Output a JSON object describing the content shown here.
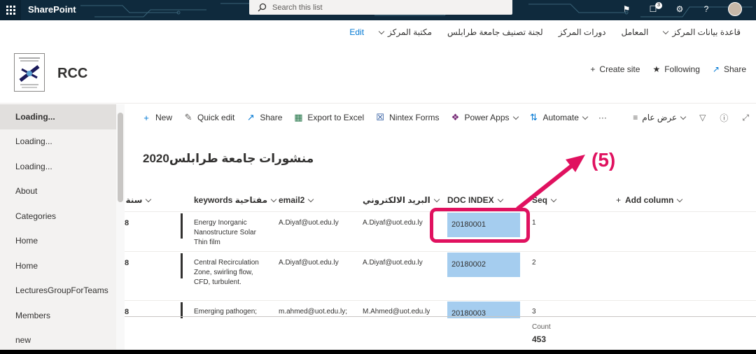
{
  "suitebar": {
    "app_name": "SharePoint",
    "search_placeholder": "Search this list",
    "notification_count": "3"
  },
  "hubnav": {
    "items": [
      "قاعدة بيانات المركز",
      "المعامل",
      "دورات المركز",
      "لجنة تصنيف جامعة طرابلس",
      "مكتبة المركز",
      "Edit"
    ]
  },
  "site": {
    "title": "RCC",
    "create_site": "Create site",
    "following": "Following",
    "share": "Share"
  },
  "leftnav": {
    "items": [
      "Loading...",
      "Loading...",
      "Loading...",
      "About",
      "Categories",
      "Home",
      "Home",
      "LecturesGroupForTeams",
      "Members",
      "new"
    ]
  },
  "commandbar": {
    "new": "New",
    "quick_edit": "Quick edit",
    "share": "Share",
    "export": "Export to Excel",
    "nintex": "Nintex Forms",
    "power_apps": "Power Apps",
    "automate": "Automate",
    "more": "···",
    "view": "عرض عام"
  },
  "list": {
    "title": "منشورات جامعة طرابلس2020",
    "columns": {
      "year": "سنة ا",
      "keywords": "keywords مفتاحية",
      "email2": "email2",
      "email_ar": "البريد الالكتروني",
      "doc_index": "DOC INDEX",
      "seq": "Seq",
      "add_column": "Add column"
    },
    "rows": [
      {
        "year": "8",
        "keywords": "Energy Inorganic Nanostructure Solar Thin film",
        "email2": "A.Diyaf@uot.edu.ly",
        "email": "A.Diyaf@uot.edu.ly",
        "doc_index": "20180001",
        "seq": "1"
      },
      {
        "year": "8",
        "keywords": "Central Recirculation Zone, swirling flow, CFD, turbulent.",
        "email2": "A.Diyaf@uot.edu.ly",
        "email": "A.Diyaf@uot.edu.ly",
        "doc_index": "20180002",
        "seq": "2"
      },
      {
        "year": "8",
        "keywords": "Emerging pathogen;",
        "email2": "m.ahmed@uot.edu.ly;",
        "email": "M.Ahmed@uot.edu.ly",
        "doc_index": "20180003",
        "seq": "3"
      }
    ],
    "count_label": "Count",
    "count_value": "453"
  },
  "annotation": {
    "label": "(5)",
    "color": "#e0115f"
  }
}
